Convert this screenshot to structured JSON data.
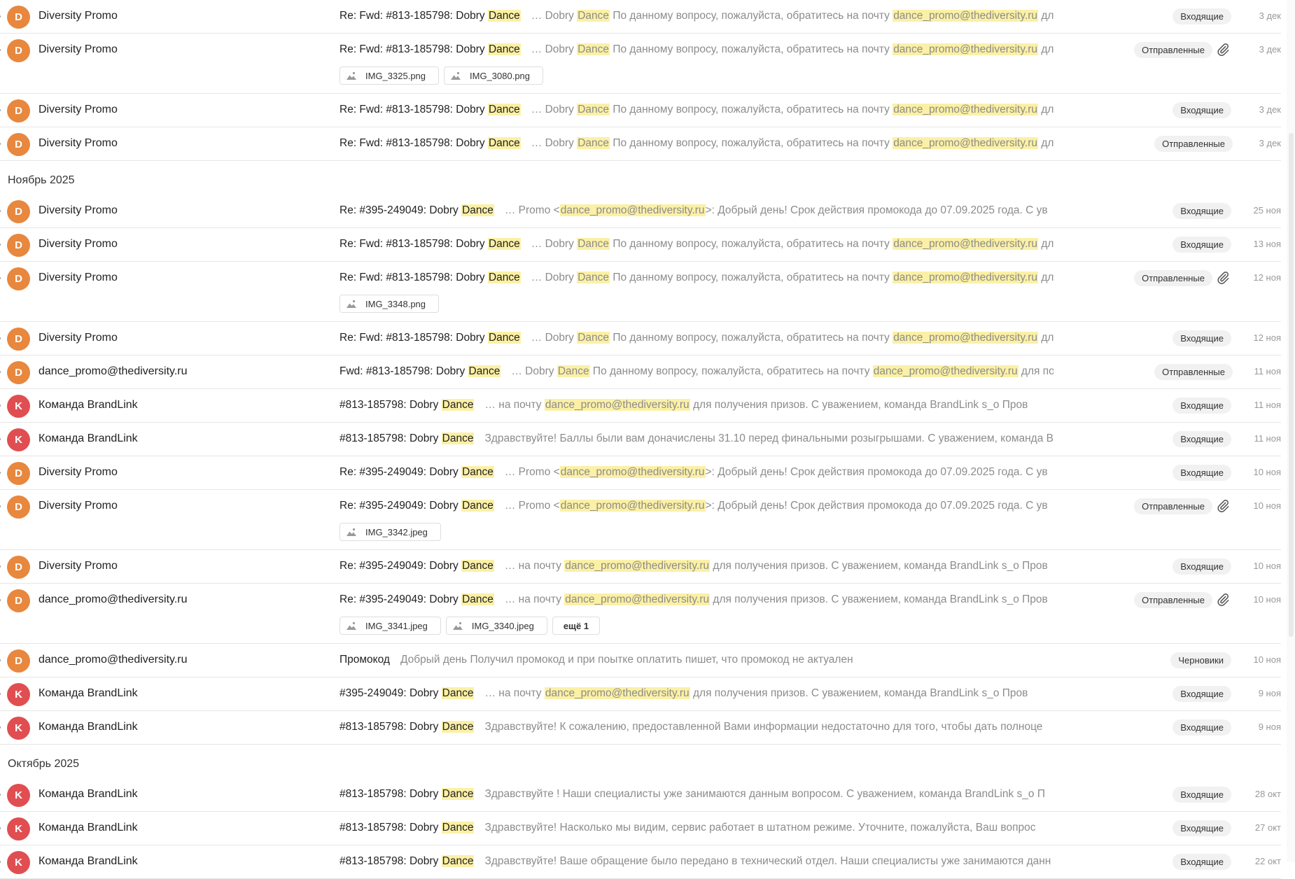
{
  "colors": {
    "avatar_D": "#e8873e",
    "avatar_K": "#e04e51",
    "highlight": "#fbf0a5",
    "folder_badge_bg": "#f1f1f1",
    "snippet_text": "#8c8c8c"
  },
  "icons": {
    "attachment": "paperclip-icon",
    "image_file": "image-icon"
  },
  "mail_list": [
    {
      "type": "row",
      "avatar": "D",
      "sender": "Diversity Promo",
      "subject": [
        {
          "t": "Re: Fwd: #813-185798: Dobry "
        },
        {
          "t": "Dance",
          "hl": true
        }
      ],
      "snippet": [
        {
          "t": "… Dobry "
        },
        {
          "t": "Dance",
          "hl": true
        },
        {
          "t": " По данному вопросу, пожалуйста, обратитесь на почту "
        },
        {
          "t": "dance_promo@thediversity.ru",
          "hl": true
        },
        {
          "t": " для по"
        }
      ],
      "folder": "Входящие",
      "date": "3 дек",
      "has_attachment": false,
      "attachments": []
    },
    {
      "type": "row",
      "avatar": "D",
      "sender": "Diversity Promo",
      "subject": [
        {
          "t": "Re: Fwd: #813-185798: Dobry "
        },
        {
          "t": "Dance",
          "hl": true
        }
      ],
      "snippet": [
        {
          "t": "… Dobry "
        },
        {
          "t": "Dance",
          "hl": true
        },
        {
          "t": " По данному вопросу, пожалуйста, обратитесь на почту "
        },
        {
          "t": "dance_promo@thediversity.ru",
          "hl": true
        },
        {
          "t": " для по"
        }
      ],
      "folder": "Отправленные",
      "date": "3 дек",
      "has_attachment": true,
      "attachments": [
        "IMG_3325.png",
        "IMG_3080.png"
      ]
    },
    {
      "type": "row",
      "avatar": "D",
      "sender": "Diversity Promo",
      "subject": [
        {
          "t": "Re: Fwd: #813-185798: Dobry "
        },
        {
          "t": "Dance",
          "hl": true
        }
      ],
      "snippet": [
        {
          "t": "… Dobry "
        },
        {
          "t": "Dance",
          "hl": true
        },
        {
          "t": " По данному вопросу, пожалуйста, обратитесь на почту "
        },
        {
          "t": "dance_promo@thediversity.ru",
          "hl": true
        },
        {
          "t": " для по"
        }
      ],
      "folder": "Входящие",
      "date": "3 дек",
      "has_attachment": false,
      "attachments": []
    },
    {
      "type": "row",
      "avatar": "D",
      "sender": "Diversity Promo",
      "subject": [
        {
          "t": "Re: Fwd: #813-185798: Dobry "
        },
        {
          "t": "Dance",
          "hl": true
        }
      ],
      "snippet": [
        {
          "t": "… Dobry "
        },
        {
          "t": "Dance",
          "hl": true
        },
        {
          "t": " По данному вопросу, пожалуйста, обратитесь на почту "
        },
        {
          "t": "dance_promo@thediversity.ru",
          "hl": true
        },
        {
          "t": " для по"
        }
      ],
      "folder": "Отправленные",
      "date": "3 дек",
      "has_attachment": false,
      "attachments": []
    },
    {
      "type": "month",
      "label": "Ноябрь 2025"
    },
    {
      "type": "row",
      "avatar": "D",
      "sender": "Diversity Promo",
      "subject": [
        {
          "t": "Re: #395-249049: Dobry "
        },
        {
          "t": "Dance",
          "hl": true
        }
      ],
      "snippet": [
        {
          "t": "… Promo <"
        },
        {
          "t": "dance_promo@thediversity.ru",
          "hl": true
        },
        {
          "t": ">: Добрый день! Срок действия промокода до 07.09.2025 года. С ув"
        }
      ],
      "folder": "Входящие",
      "date": "25 ноя",
      "has_attachment": false,
      "attachments": []
    },
    {
      "type": "row",
      "avatar": "D",
      "sender": "Diversity Promo",
      "subject": [
        {
          "t": "Re: Fwd: #813-185798: Dobry "
        },
        {
          "t": "Dance",
          "hl": true
        }
      ],
      "snippet": [
        {
          "t": "… Dobry "
        },
        {
          "t": "Dance",
          "hl": true
        },
        {
          "t": " По данному вопросу, пожалуйста, обратитесь на почту "
        },
        {
          "t": "dance_promo@thediversity.ru",
          "hl": true
        },
        {
          "t": " для по"
        }
      ],
      "folder": "Входящие",
      "date": "13 ноя",
      "has_attachment": false,
      "attachments": []
    },
    {
      "type": "row",
      "avatar": "D",
      "sender": "Diversity Promo",
      "subject": [
        {
          "t": "Re: Fwd: #813-185798: Dobry "
        },
        {
          "t": "Dance",
          "hl": true
        }
      ],
      "snippet": [
        {
          "t": "… Dobry "
        },
        {
          "t": "Dance",
          "hl": true
        },
        {
          "t": " По данному вопросу, пожалуйста, обратитесь на почту "
        },
        {
          "t": "dance_promo@thediversity.ru",
          "hl": true
        },
        {
          "t": " для по"
        }
      ],
      "folder": "Отправленные",
      "date": "12 ноя",
      "has_attachment": true,
      "attachments": [
        "IMG_3348.png"
      ]
    },
    {
      "type": "row",
      "avatar": "D",
      "sender": "Diversity Promo",
      "subject": [
        {
          "t": "Re: Fwd: #813-185798: Dobry "
        },
        {
          "t": "Dance",
          "hl": true
        }
      ],
      "snippet": [
        {
          "t": "… Dobry "
        },
        {
          "t": "Dance",
          "hl": true
        },
        {
          "t": " По данному вопросу, пожалуйста, обратитесь на почту "
        },
        {
          "t": "dance_promo@thediversity.ru",
          "hl": true
        },
        {
          "t": " для по"
        }
      ],
      "folder": "Входящие",
      "date": "12 ноя",
      "has_attachment": false,
      "attachments": []
    },
    {
      "type": "row",
      "avatar": "D",
      "sender": "dance_promo@thediversity.ru",
      "subject": [
        {
          "t": "Fwd: #813-185798: Dobry "
        },
        {
          "t": "Dance",
          "hl": true
        }
      ],
      "snippet": [
        {
          "t": "… Dobry "
        },
        {
          "t": "Dance",
          "hl": true
        },
        {
          "t": " По данному вопросу, пожалуйста, обратитесь на почту "
        },
        {
          "t": "dance_promo@thediversity.ru",
          "hl": true
        },
        {
          "t": " для по"
        }
      ],
      "folder": "Отправленные",
      "date": "11 ноя",
      "has_attachment": false,
      "attachments": []
    },
    {
      "type": "row",
      "avatar": "K",
      "sender": "Команда BrandLink",
      "subject": [
        {
          "t": "#813-185798: Dobry "
        },
        {
          "t": "Dance",
          "hl": true
        }
      ],
      "snippet": [
        {
          "t": "… на почту "
        },
        {
          "t": "dance_promo@thediversity.ru",
          "hl": true
        },
        {
          "t": " для получения призов. С уважением, команда BrandLink s_o Пров"
        }
      ],
      "folder": "Входящие",
      "date": "11 ноя",
      "has_attachment": false,
      "attachments": []
    },
    {
      "type": "row",
      "avatar": "K",
      "sender": "Команда BrandLink",
      "subject": [
        {
          "t": "#813-185798: Dobry "
        },
        {
          "t": "Dance",
          "hl": true
        }
      ],
      "snippet": [
        {
          "t": "Здравствуйте! Баллы были вам доначислены 31.10 перед финальными розыгрышами. С уважением, команда Br"
        }
      ],
      "folder": "Входящие",
      "date": "11 ноя",
      "has_attachment": false,
      "attachments": []
    },
    {
      "type": "row",
      "avatar": "D",
      "sender": "Diversity Promo",
      "subject": [
        {
          "t": "Re: #395-249049: Dobry "
        },
        {
          "t": "Dance",
          "hl": true
        }
      ],
      "snippet": [
        {
          "t": "… Promo <"
        },
        {
          "t": "dance_promo@thediversity.ru",
          "hl": true
        },
        {
          "t": ">: Добрый день! Срок действия промокода до 07.09.2025 года. С ув"
        }
      ],
      "folder": "Входящие",
      "date": "10 ноя",
      "has_attachment": false,
      "attachments": []
    },
    {
      "type": "row",
      "avatar": "D",
      "sender": "Diversity Promo",
      "subject": [
        {
          "t": "Re: #395-249049: Dobry "
        },
        {
          "t": "Dance",
          "hl": true
        }
      ],
      "snippet": [
        {
          "t": "… Promo <"
        },
        {
          "t": "dance_promo@thediversity.ru",
          "hl": true
        },
        {
          "t": ">: Добрый день! Срок действия промокода до 07.09.2025 года. С ув"
        }
      ],
      "folder": "Отправленные",
      "date": "10 ноя",
      "has_attachment": true,
      "attachments": [
        "IMG_3342.jpeg"
      ]
    },
    {
      "type": "row",
      "avatar": "D",
      "sender": "Diversity Promo",
      "subject": [
        {
          "t": "Re: #395-249049: Dobry "
        },
        {
          "t": "Dance",
          "hl": true
        }
      ],
      "snippet": [
        {
          "t": "… на почту "
        },
        {
          "t": "dance_promo@thediversity.ru",
          "hl": true
        },
        {
          "t": " для получения призов. С уважением, команда BrandLink s_o Пров"
        }
      ],
      "folder": "Входящие",
      "date": "10 ноя",
      "has_attachment": false,
      "attachments": []
    },
    {
      "type": "row",
      "avatar": "D",
      "sender": "dance_promo@thediversity.ru",
      "subject": [
        {
          "t": "Re: #395-249049: Dobry "
        },
        {
          "t": "Dance",
          "hl": true
        }
      ],
      "snippet": [
        {
          "t": "… на почту "
        },
        {
          "t": "dance_promo@thediversity.ru",
          "hl": true
        },
        {
          "t": " для получения призов. С уважением, команда BrandLink s_o Пров"
        }
      ],
      "folder": "Отправленные",
      "date": "10 ноя",
      "has_attachment": true,
      "attachments": [
        "IMG_3341.jpeg",
        "IMG_3340.jpeg"
      ],
      "more_label": "ещё 1"
    },
    {
      "type": "row",
      "avatar": "D",
      "sender": "dance_promo@thediversity.ru",
      "subject": [
        {
          "t": "Промокод"
        }
      ],
      "snippet": [
        {
          "t": "Добрый день Получил промокод и при поытке оплатить пишет, что промокод не актуален"
        }
      ],
      "folder": "Черновики",
      "date": "10 ноя",
      "has_attachment": false,
      "attachments": []
    },
    {
      "type": "row",
      "avatar": "K",
      "sender": "Команда BrandLink",
      "subject": [
        {
          "t": "#395-249049: Dobry "
        },
        {
          "t": "Dance",
          "hl": true
        }
      ],
      "snippet": [
        {
          "t": "… на почту "
        },
        {
          "t": "dance_promo@thediversity.ru",
          "hl": true
        },
        {
          "t": " для получения призов. С уважением, команда BrandLink s_o Пров"
        }
      ],
      "folder": "Входящие",
      "date": "9 ноя",
      "has_attachment": false,
      "attachments": []
    },
    {
      "type": "row",
      "avatar": "K",
      "sender": "Команда BrandLink",
      "subject": [
        {
          "t": "#813-185798: Dobry "
        },
        {
          "t": "Dance",
          "hl": true
        }
      ],
      "snippet": [
        {
          "t": "Здравствуйте! К сожалению, предоставленной Вами информации недостаточно для того, чтобы дать полноце"
        }
      ],
      "folder": "Входящие",
      "date": "9 ноя",
      "has_attachment": false,
      "attachments": []
    },
    {
      "type": "month",
      "label": "Октябрь 2025"
    },
    {
      "type": "row",
      "avatar": "K",
      "sender": "Команда BrandLink",
      "subject": [
        {
          "t": "#813-185798: Dobry "
        },
        {
          "t": "Dance",
          "hl": true
        }
      ],
      "snippet": [
        {
          "t": "Здравствуйте ! Наши специалисты уже занимаются данным вопросом. С уважением, команда BrandLink s_o П"
        }
      ],
      "folder": "Входящие",
      "date": "28 окт",
      "has_attachment": false,
      "attachments": []
    },
    {
      "type": "row",
      "avatar": "K",
      "sender": "Команда BrandLink",
      "subject": [
        {
          "t": "#813-185798: Dobry "
        },
        {
          "t": "Dance",
          "hl": true
        }
      ],
      "snippet": [
        {
          "t": "Здравствуйте! Насколько мы видим, сервис работает в штатном режиме. Уточните, пожалуйста, Ваш вопрос"
        }
      ],
      "folder": "Входящие",
      "date": "27 окт",
      "has_attachment": false,
      "attachments": []
    },
    {
      "type": "row",
      "avatar": "K",
      "sender": "Команда BrandLink",
      "subject": [
        {
          "t": "#813-185798: Dobry "
        },
        {
          "t": "Dance",
          "hl": true
        }
      ],
      "snippet": [
        {
          "t": "Здравствуйте! Ваше обращение было передано в технический отдел. Наши специалисты уже занимаются данн"
        }
      ],
      "folder": "Входящие",
      "date": "22 окт",
      "has_attachment": false,
      "attachments": []
    }
  ]
}
